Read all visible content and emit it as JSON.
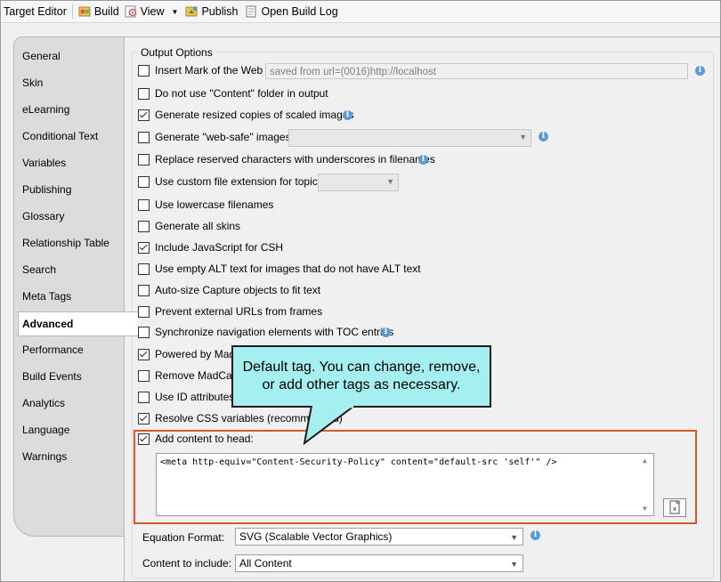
{
  "toolbar": {
    "target_editor": "Target Editor",
    "build": "Build",
    "view": "View",
    "publish": "Publish",
    "open_build_log": "Open Build Log"
  },
  "tabs": [
    {
      "label": "General"
    },
    {
      "label": "Skin"
    },
    {
      "label": "eLearning"
    },
    {
      "label": "Conditional Text"
    },
    {
      "label": "Variables"
    },
    {
      "label": "Publishing"
    },
    {
      "label": "Glossary"
    },
    {
      "label": "Relationship Table"
    },
    {
      "label": "Search"
    },
    {
      "label": "Meta Tags"
    },
    {
      "label": "Advanced",
      "active": true
    },
    {
      "label": "Performance"
    },
    {
      "label": "Build Events"
    },
    {
      "label": "Analytics"
    },
    {
      "label": "Language"
    },
    {
      "label": "Warnings"
    }
  ],
  "output_options": {
    "title": "Output Options",
    "insert_mark_of_web": {
      "label": "Insert Mark of the Web",
      "checked": false,
      "value": "saved from url=(0016)http://localhost"
    },
    "no_content_folder": {
      "label": "Do not use \"Content\" folder in output",
      "checked": false
    },
    "resized_images": {
      "label": "Generate resized copies of scaled images",
      "checked": true
    },
    "web_safe_images": {
      "label": "Generate \"web-safe\" images",
      "checked": false
    },
    "replace_reserved": {
      "label": "Replace reserved characters with underscores in filenames",
      "checked": false
    },
    "custom_extension": {
      "label": "Use custom file extension for topics",
      "checked": false
    },
    "lowercase_filenames": {
      "label": "Use lowercase filenames",
      "checked": false
    },
    "all_skins": {
      "label": "Generate all skins",
      "checked": false
    },
    "include_js_csh": {
      "label": "Include JavaScript for CSH",
      "checked": true
    },
    "empty_alt": {
      "label": "Use empty ALT text for images that do not have ALT text",
      "checked": false
    },
    "auto_size_capture": {
      "label": "Auto-size Capture objects to fit text",
      "checked": false
    },
    "prevent_external_urls": {
      "label": "Prevent external URLs from frames",
      "checked": false
    },
    "sync_nav": {
      "label": "Synchronize navigation elements with TOC entries",
      "checked": false
    },
    "powered_by": {
      "label": "Powered by MadC",
      "checked": true
    },
    "remove_madcap": {
      "label": "Remove MadCap s",
      "checked": false
    },
    "use_id_attributes": {
      "label": "Use ID attributes",
      "checked": false
    },
    "resolve_css": {
      "label": "Resolve CSS variables (recommended)",
      "checked": true
    },
    "add_content_head": {
      "label": "Add content to head:",
      "checked": true,
      "value": "<meta http-equiv=\"Content-Security-Policy\" content=\"default-src 'self'\" />"
    },
    "equation_format": {
      "label": "Equation Format:",
      "value": "SVG (Scalable Vector Graphics)"
    },
    "content_to_include": {
      "label": "Content to include:",
      "value": "All Content"
    }
  },
  "callout": {
    "line1": "Default tag. You can change, remove,",
    "line2": "or add other tags as necessary."
  },
  "colors": {
    "callout_bg": "#a6eff0",
    "highlight_border": "#d5572e",
    "info_icon": "#5b9bd5"
  }
}
